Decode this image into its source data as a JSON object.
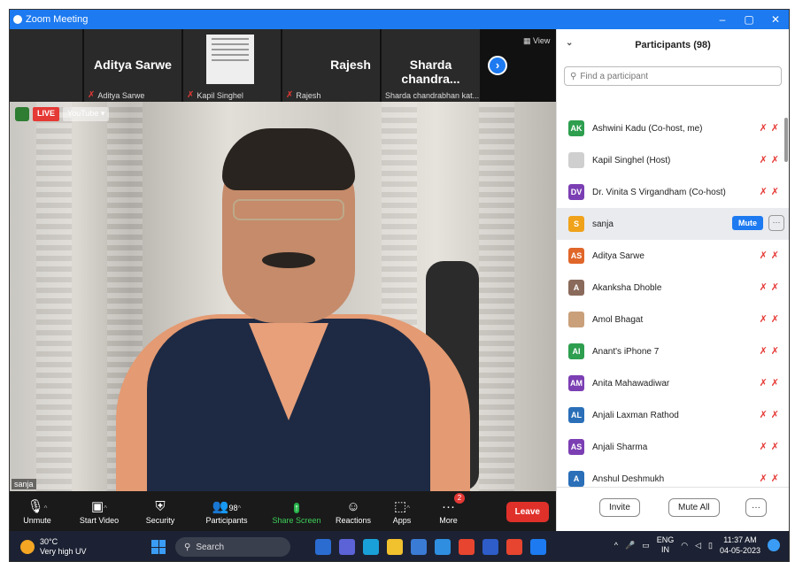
{
  "window": {
    "title": "Zoom Meeting",
    "controls": [
      "–",
      "▢",
      "✕"
    ]
  },
  "strip": {
    "tiles": [
      {
        "big": "",
        "small": ""
      },
      {
        "big": "Aditya Sarwe",
        "small": "Aditya Sarwe"
      },
      {
        "big": "",
        "small": "Kapil Singhel"
      },
      {
        "big": "Rajesh",
        "small": "Rajesh"
      },
      {
        "big": "Sharda  chandra...",
        "small": "Sharda chandrabhan kat..."
      }
    ],
    "view_label": "View"
  },
  "video": {
    "live_label": "LIVE",
    "youtube_label": "YouTube",
    "self_name": "sanja"
  },
  "toolbar": {
    "unmute": "Unmute",
    "start_video": "Start Video",
    "security": "Security",
    "participants": "Participants",
    "participants_count": "98",
    "share_screen": "Share Screen",
    "reactions": "Reactions",
    "apps": "Apps",
    "more": "More",
    "more_badge": "2",
    "leave": "Leave"
  },
  "panel": {
    "title": "Participants (98)",
    "search_placeholder": "Find a participant",
    "participants": [
      {
        "initials": "AK",
        "name": "Ashwini Kadu (Co-host, me)",
        "color": "#2e9e4f"
      },
      {
        "initials": "",
        "name": "Kapil Singhel (Host)",
        "color": "#cfcfcf"
      },
      {
        "initials": "DV",
        "name": "Dr. Vinita  S Virgandham (Co-host)",
        "color": "#7b3fb3"
      },
      {
        "initials": "S",
        "name": "sanja",
        "color": "#f0a21a"
      },
      {
        "initials": "AS",
        "name": "Aditya Sarwe",
        "color": "#e0662a"
      },
      {
        "initials": "A",
        "name": "Akanksha Dhoble",
        "color": "#8a6a5a"
      },
      {
        "initials": "",
        "name": "Amol Bhagat",
        "color": "#c9a07a"
      },
      {
        "initials": "AI",
        "name": "Anant's iPhone 7",
        "color": "#2e9e4f"
      },
      {
        "initials": "AM",
        "name": "Anita Mahawadiwar",
        "color": "#7b3fb3"
      },
      {
        "initials": "AL",
        "name": "Anjali Laxman Rathod",
        "color": "#2a6fb8"
      },
      {
        "initials": "AS",
        "name": "Anjali Sharma",
        "color": "#7b3fb3"
      },
      {
        "initials": "A",
        "name": "Anshul Deshmukh",
        "color": "#2a6fb8"
      }
    ],
    "mute_label": "Mute",
    "more_label": "···",
    "invite": "Invite",
    "mute_all": "Mute All",
    "footer_more": "···"
  },
  "taskbar": {
    "temp": "30°C",
    "weather": "Very high UV",
    "search": "Search",
    "lang1": "ENG",
    "lang2": "IN",
    "time": "11:37 AM",
    "date": "04-05-2023"
  }
}
